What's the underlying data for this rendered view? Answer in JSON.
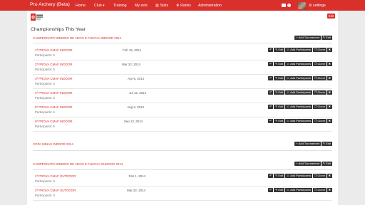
{
  "nav": {
    "brand": "Pro Archery (Beta)",
    "items": [
      {
        "label": "Home"
      },
      {
        "label": "Club"
      },
      {
        "label": "Training"
      },
      {
        "label": "My sets"
      },
      {
        "label": "Stats"
      },
      {
        "label": "Ranks"
      },
      {
        "label": "Administration"
      }
    ],
    "mail_count": "2",
    "settings_label": "settings"
  },
  "header": {
    "edit_label": "Edit",
    "page_title": "Championships This Year"
  },
  "buttons": {
    "add_tournament": "Add Tournament",
    "edit": "Edit",
    "add_participants": "Add Participants",
    "clone": "Clone"
  },
  "championships": [
    {
      "title": "CAMPEONATO MINEIRO DE ARCO E FLECHA INDOOR 2014",
      "tournaments": [
        {
          "name": "1ª PROVA CMAF INDOOR",
          "date": "Feb 15, 2014",
          "participants": "Participants: 6"
        },
        {
          "name": "2ª PROVA CMAF INDOOR",
          "date": "Mar 22, 2014",
          "participants": "Participants: 6"
        },
        {
          "name": "3ª PROVA CMAF INDOOR",
          "date": "Apr 5, 2014",
          "participants": "Participants: 6"
        },
        {
          "name": "4ª PROVA CMAF INDOOR",
          "date": "Jul 12, 2014",
          "participants": "Participants: 6"
        },
        {
          "name": "5ª PROVA CMAF INDOOR",
          "date": "Aug 2, 2014",
          "participants": "Participants: 6"
        },
        {
          "name": "6ª PROVA CMAF INDOOR",
          "date": "Sep 13, 2014",
          "participants": "Participants: 6"
        }
      ]
    },
    {
      "title": "COPA MINAS INDOOR 2014",
      "tournaments": []
    },
    {
      "title": "CAMPEONATO MINEIRO DE ARCO E FLECHA OUDOOR 2014",
      "tournaments": [
        {
          "name": "1ª PROVA CMAF OUTDOOR",
          "date": "Feb 1, 2014",
          "participants": "Participants: 0"
        },
        {
          "name": "2ª PROVA CMAF OUTDOOR",
          "date": "Mar 22, 2014",
          "participants": "Participants: 0"
        }
      ]
    }
  ],
  "colors": {
    "brand": "#d9302c",
    "button": "#333333"
  }
}
